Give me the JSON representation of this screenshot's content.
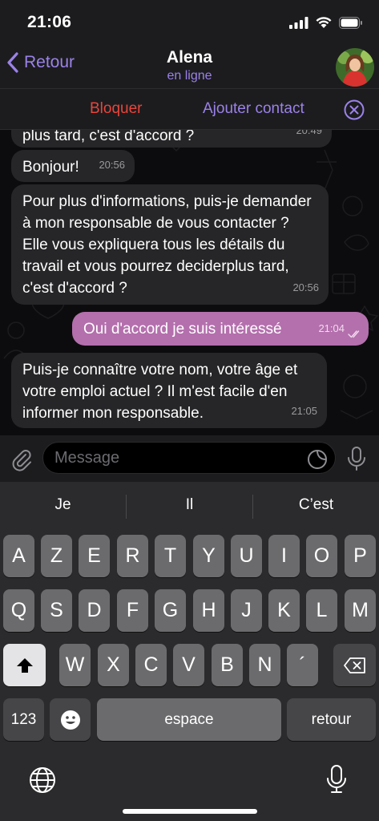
{
  "status_bar": {
    "time": "21:06"
  },
  "header": {
    "back_label": "Retour",
    "title": "Alena",
    "subtitle": "en ligne",
    "avatar_icon": "profile-photo"
  },
  "action_bar": {
    "block_label": "Bloquer",
    "add_contact_label": "Ajouter contact",
    "block_color": "#e8453c",
    "accent_color": "#9b82ea"
  },
  "messages": [
    {
      "direction": "in",
      "text": "plus tard, c'est d'accord ?",
      "time": "20:49"
    },
    {
      "direction": "in",
      "text": "Bonjour!",
      "time": "20:56"
    },
    {
      "direction": "in",
      "text": "Pour plus d'informations, puis-je demander à mon responsable de vous contacter ? Elle vous expliquera tous les détails du travail et vous pourrez deciderplus tard, c'est d'accord ?",
      "time": "20:56"
    },
    {
      "direction": "out",
      "text": "Oui d'accord je suis intéressé",
      "time": "21:04",
      "status": "read"
    },
    {
      "direction": "in",
      "text": "Puis-je connaître votre nom, votre âge et votre emploi actuel ? Il m'est facile d'en informer mon responsable.",
      "time": "21:05"
    }
  ],
  "composer": {
    "placeholder": "Message",
    "value": ""
  },
  "keyboard": {
    "suggestions": [
      "Je",
      "Il",
      "C’est"
    ],
    "row1": [
      "A",
      "Z",
      "E",
      "R",
      "T",
      "Y",
      "U",
      "I",
      "O",
      "P"
    ],
    "row2": [
      "Q",
      "S",
      "D",
      "F",
      "G",
      "H",
      "J",
      "K",
      "L",
      "M"
    ],
    "row3": [
      "W",
      "X",
      "C",
      "V",
      "B",
      "N",
      "´"
    ],
    "numbers_label": "123",
    "space_label": "espace",
    "return_label": "retour"
  },
  "colors": {
    "outgoing_bubble": "#b46fad",
    "incoming_bubble": "#262628",
    "background": "#0c0c0e"
  }
}
